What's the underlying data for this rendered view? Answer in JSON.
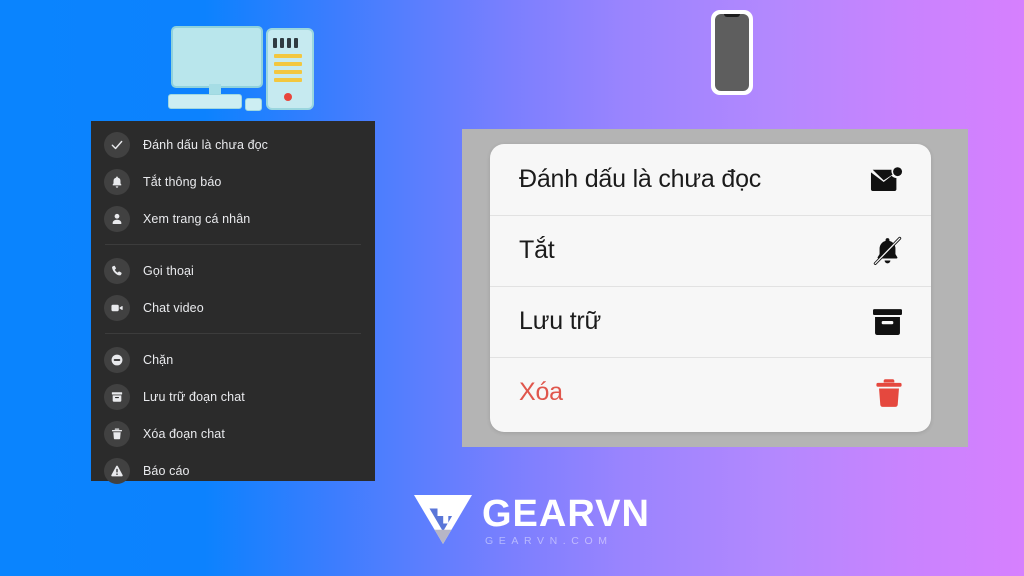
{
  "background": {
    "gradient_from": "#0a84fe",
    "gradient_mid": "#7b7ffe",
    "gradient_to": "#d680fe"
  },
  "devices": {
    "desktop_icon": "desktop-computer-emoji",
    "desktop_glyph": "🖥️",
    "phone_icon": "mobile-phone-emoji",
    "phone_glyph": "📱"
  },
  "desktop_menu": {
    "name": "messenger-desktop-context-menu",
    "background_color": "#2b2b2b",
    "text_color": "#e9eaed",
    "groups": [
      {
        "items": [
          {
            "label": "Đánh dấu là chưa đọc",
            "icon": "check-icon"
          },
          {
            "label": "Tắt thông báo",
            "icon": "bell-icon"
          },
          {
            "label": "Xem trang cá nhân",
            "icon": "person-icon"
          }
        ]
      },
      {
        "items": [
          {
            "label": "Gọi thoại",
            "icon": "phone-call-icon"
          },
          {
            "label": "Chat video",
            "icon": "video-camera-icon"
          }
        ]
      },
      {
        "items": [
          {
            "label": "Chặn",
            "icon": "block-icon"
          },
          {
            "label": "Lưu trữ đoạn chat",
            "icon": "archive-icon"
          },
          {
            "label": "Xóa đoạn chat",
            "icon": "trash-icon"
          },
          {
            "label": "Báo cáo",
            "icon": "warning-triangle-icon"
          }
        ]
      }
    ]
  },
  "ios_menu": {
    "name": "messenger-ios-action-sheet",
    "backdrop_color": "#b4b4b4",
    "sheet_color": "#f7f7f7",
    "danger_color": "#e0564c",
    "rows": [
      {
        "label": "Đánh dấu là chưa đọc",
        "icon": "unread-mail-icon",
        "danger": false
      },
      {
        "label": "Tắt",
        "icon": "bell-slash-icon",
        "danger": false
      },
      {
        "label": "Lưu trữ",
        "icon": "archive-box-icon",
        "danger": false
      },
      {
        "label": "Xóa",
        "icon": "trash-can-icon",
        "danger": true
      }
    ]
  },
  "logo": {
    "wordmark": "GEARVN",
    "subwordmark": "GEARVN.COM",
    "mark_icon": "gearvn-triangle-logo"
  }
}
